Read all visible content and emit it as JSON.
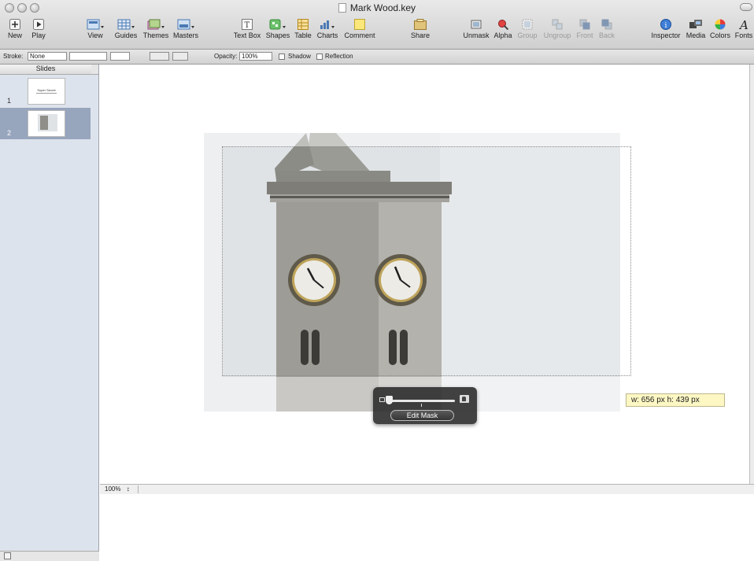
{
  "window": {
    "title": "Mark Wood.key"
  },
  "toolbar": {
    "new": "New",
    "play": "Play",
    "view": "View",
    "guides": "Guides",
    "themes": "Themes",
    "masters": "Masters",
    "text_box": "Text Box",
    "shapes": "Shapes",
    "table": "Table",
    "charts": "Charts",
    "comment": "Comment",
    "share": "Share",
    "unmask": "Unmask",
    "alpha": "Alpha",
    "group": "Group",
    "ungroup": "Ungroup",
    "front": "Front",
    "back": "Back",
    "inspector": "Inspector",
    "media": "Media",
    "colors": "Colors",
    "fonts": "Fonts"
  },
  "format_bar": {
    "stroke_label": "Stroke:",
    "stroke_value": "None",
    "opacity_label": "Opacity:",
    "opacity_value": "100%",
    "shadow": "Shadow",
    "reflection": "Reflection"
  },
  "sidebar": {
    "header": "Slides",
    "slides": [
      {
        "number": "1",
        "caption": "Super Secret"
      },
      {
        "number": "2",
        "caption": ""
      }
    ]
  },
  "canvas": {
    "zoom": "100%"
  },
  "mask_hud": {
    "button": "Edit Mask"
  },
  "size_tooltip": {
    "text": "w: 656 px   h: 439 px"
  },
  "colors": {
    "selected_slide": "#97a5bd",
    "sidebar_bg": "#dde3ec",
    "tooltip_bg": "#fdf7c4",
    "hud_bg": "#282828"
  }
}
